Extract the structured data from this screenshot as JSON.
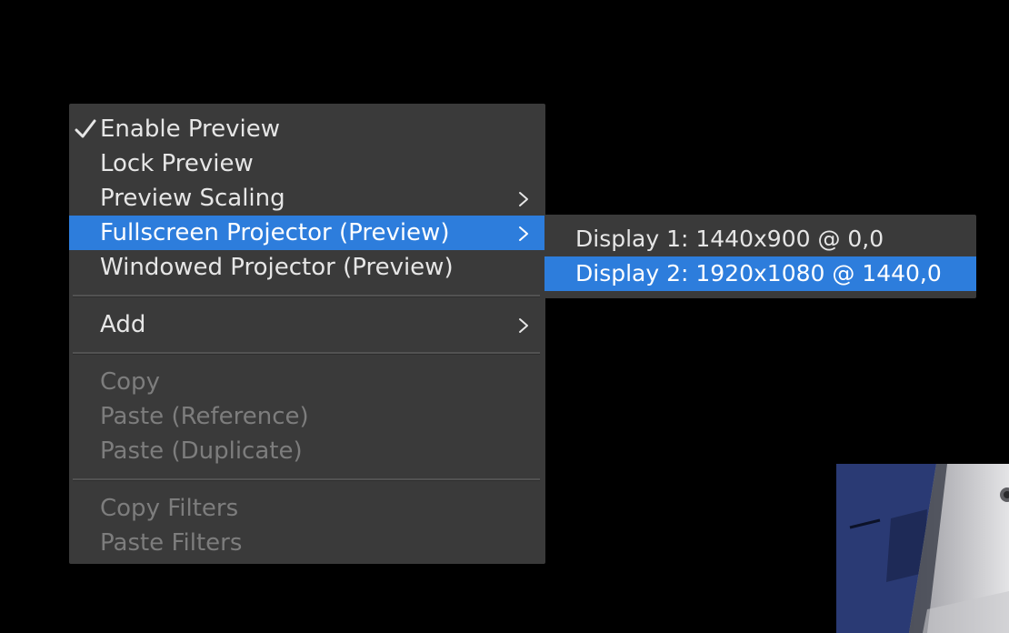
{
  "menu": {
    "items": [
      {
        "label": "Enable Preview",
        "checked": true
      },
      {
        "label": "Lock Preview"
      },
      {
        "label": "Preview Scaling",
        "submenu": true
      },
      {
        "label": "Fullscreen Projector (Preview)",
        "submenu": true,
        "highlighted": true
      },
      {
        "label": "Windowed Projector (Preview)"
      }
    ],
    "add": {
      "label": "Add",
      "submenu": true
    },
    "clipboard": [
      {
        "label": "Copy",
        "disabled": true
      },
      {
        "label": "Paste (Reference)",
        "disabled": true
      },
      {
        "label": "Paste (Duplicate)",
        "disabled": true
      }
    ],
    "filters": [
      {
        "label": "Copy Filters",
        "disabled": true
      },
      {
        "label": "Paste Filters",
        "disabled": true
      }
    ]
  },
  "submenu": {
    "items": [
      {
        "label": "Display 1: 1440x900 @ 0,0"
      },
      {
        "label": "Display 2: 1920x1080 @ 1440,0",
        "highlighted": true
      }
    ]
  },
  "colors": {
    "menu_bg": "#3a3a3a",
    "highlight": "#2d7ddc",
    "text": "#e6e6e6",
    "disabled_text": "#7d7d7d",
    "background": "#000000"
  },
  "icons": {
    "checkmark": "checkmark-icon",
    "submenu_arrow": "chevron-right-icon"
  }
}
